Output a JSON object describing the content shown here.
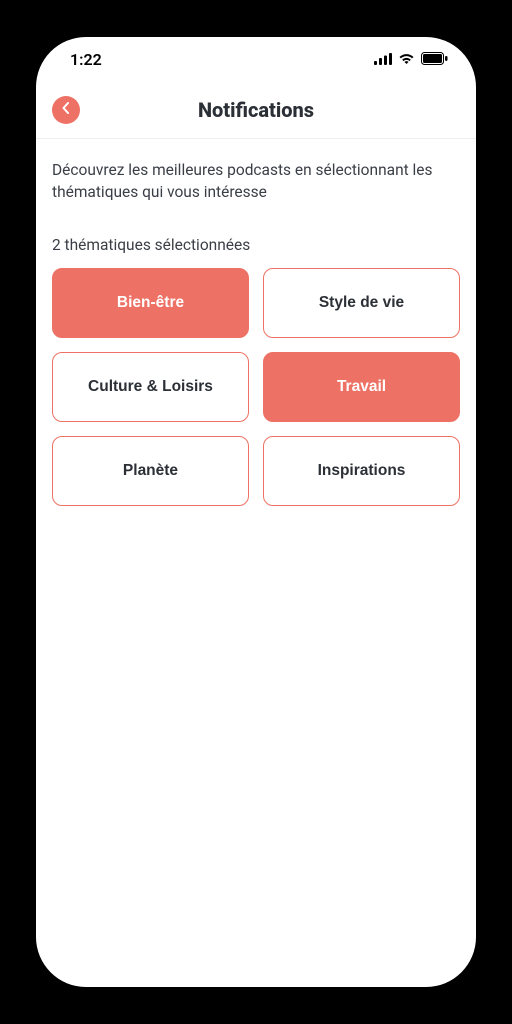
{
  "status": {
    "time": "1:22"
  },
  "header": {
    "title": "Notifications"
  },
  "intro": "Découvrez les meilleures podcasts en sélectionnant les thématiques qui vous intéresse",
  "count": "2 thématiques sélectionnées",
  "topics": [
    {
      "label": "Bien-être",
      "selected": true
    },
    {
      "label": "Style de vie",
      "selected": false
    },
    {
      "label": "Culture & Loisirs",
      "selected": false
    },
    {
      "label": "Travail",
      "selected": true
    },
    {
      "label": "Planète",
      "selected": false
    },
    {
      "label": "Inspirations",
      "selected": false
    }
  ],
  "colors": {
    "accent": "#ED7265"
  }
}
